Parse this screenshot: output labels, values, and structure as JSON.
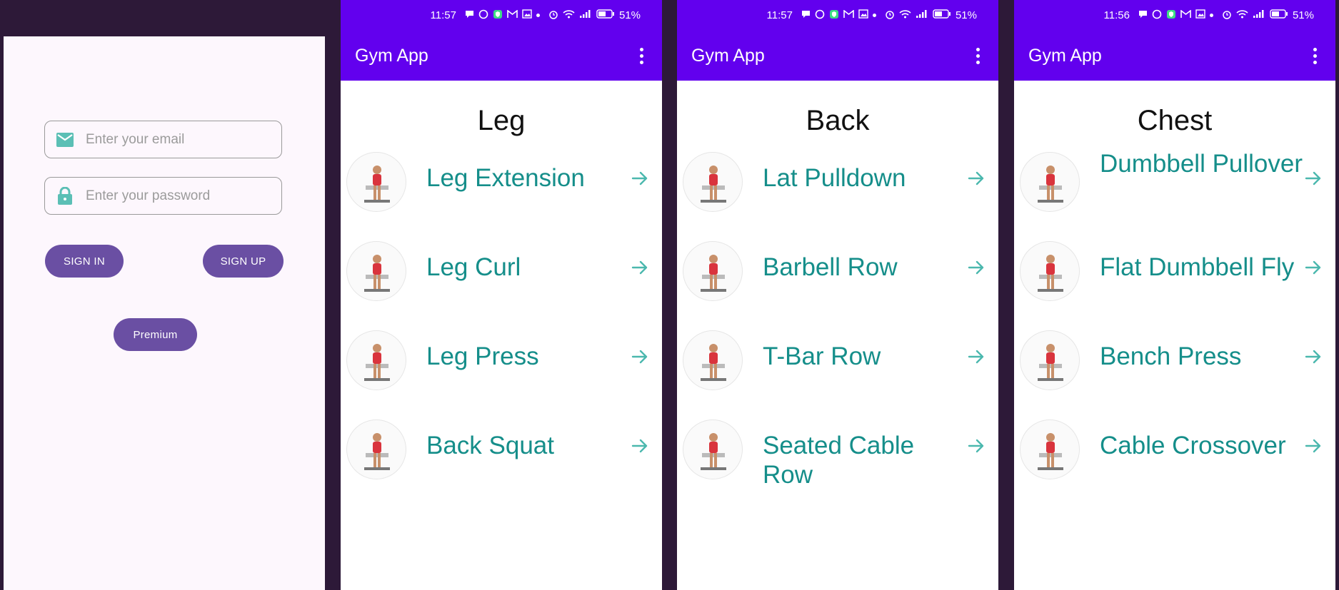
{
  "login": {
    "email_placeholder": "Enter your email",
    "password_placeholder": "Enter your password",
    "sign_in_label": "SIGN IN",
    "sign_up_label": "SIGN UP",
    "premium_label": "Premium"
  },
  "status_bars": [
    {
      "time": "11:57",
      "battery": "51%"
    },
    {
      "time": "11:57",
      "battery": "51%"
    },
    {
      "time": "11:56",
      "battery": "51%"
    }
  ],
  "app": {
    "title": "Gym App"
  },
  "screens": [
    {
      "category": "Leg",
      "exercises": [
        "Leg Extension",
        "Leg Curl",
        "Leg Press",
        "Back Squat"
      ]
    },
    {
      "category": "Back",
      "exercises": [
        "Lat Pulldown",
        "Barbell Row",
        "T-Bar Row",
        "Seated Cable Row"
      ]
    },
    {
      "category": "Chest",
      "exercises": [
        "Dumbbell Pullover",
        "Flat Dumbbell Fly",
        "Bench Press",
        "Cable Crossover"
      ]
    }
  ],
  "colors": {
    "primary": "#6200ee",
    "accent_teal": "#158e8a",
    "button_purple": "#6a4fa3",
    "background_dark": "#2d1938",
    "login_bg": "#fdf7fd"
  }
}
